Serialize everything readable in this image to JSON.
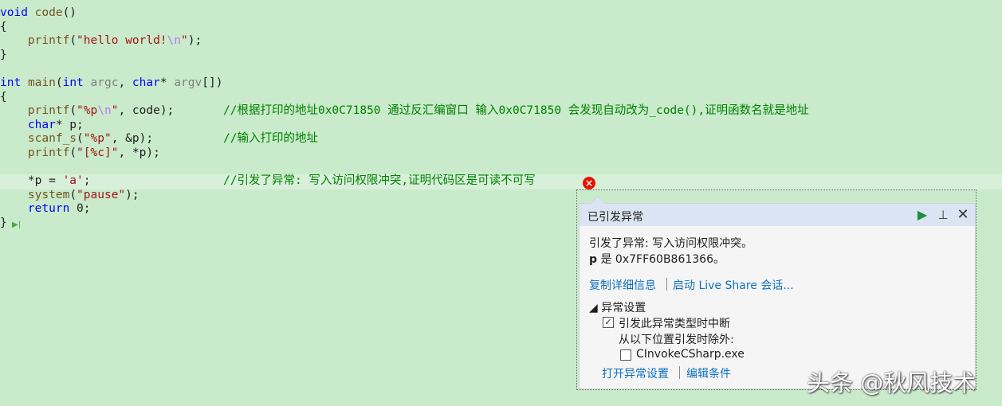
{
  "code": {
    "l1_kw": "void",
    "l1_fn": "code",
    "l1_rest": "()",
    "l2": "{",
    "l3_fn": "printf",
    "l3_p1": "(",
    "l3_str1": "\"hello world!",
    "l3_esc": "\\n",
    "l3_str2": "\"",
    "l3_end": ");",
    "l4": "}",
    "l6_kw": "int",
    "l6_fn": "main",
    "l6_p1": "(",
    "l6_kw2": "int",
    "l6_par1": "argc",
    "l6_comma": ", ",
    "l6_kw3": "char",
    "l6_star": "* ",
    "l6_par2": "argv",
    "l6_end": "[])",
    "l7": "{",
    "l8_fn": "printf",
    "l8_p1": "(",
    "l8_str1": "\"%p",
    "l8_esc": "\\n",
    "l8_str2": "\"",
    "l8_rest": ", code);",
    "l8_cmt": "//根据打印的地址0x0C71850 通过反汇编窗口 输入0x0C71850 会发现自动改为_code(),证明函数名就是地址",
    "l9_kw": "char",
    "l9_rest": "* p;",
    "l10_fn": "scanf_s",
    "l10_p1": "(",
    "l10_str": "\"%p\"",
    "l10_rest": ", &p);",
    "l10_cmt": "//输入打印的地址",
    "l11_fn": "printf",
    "l11_p1": "(",
    "l11_str": "\"[%c]\"",
    "l11_rest": ", *p);",
    "l13_code": "*p = ",
    "l13_str": "'a'",
    "l13_end": ";",
    "l13_cmt": "//引发了异常: 写入访问权限冲突,证明代码区是可读不可写",
    "l14_fn": "system",
    "l14_p1": "(",
    "l14_str": "\"pause\"",
    "l14_end": ");",
    "l15_kw": "return",
    "l15_rest": " 0;",
    "l16": "}"
  },
  "error_icon": "×",
  "exec_marker": "▶|",
  "popup": {
    "title": "已引发异常",
    "message": "引发了异常: 写入访问权限冲突。",
    "var_name": "p",
    "var_rest": " 是 0x7FF60B861366。",
    "link_copy": "复制详细信息",
    "link_liveshare": "启动 Live Share 会话...",
    "settings_header": "◢ 异常设置",
    "break_checkbox_mark": "✓",
    "break_label": "引发此异常类型时中断",
    "except_label": "从以下位置引发时除外:",
    "module_label": "CInvokeCSharp.exe",
    "link_open_settings": "打开异常设置",
    "link_edit_conditions": "编辑条件",
    "icon_play": "▶",
    "icon_pin": "⊥",
    "icon_close": "✕"
  },
  "watermark": "头条 @秋风技术",
  "colors": {
    "editor_background": "#c9ebcb",
    "popup_header": "#dbe4f2",
    "link": "#0e70c0",
    "error": "#e51400"
  }
}
